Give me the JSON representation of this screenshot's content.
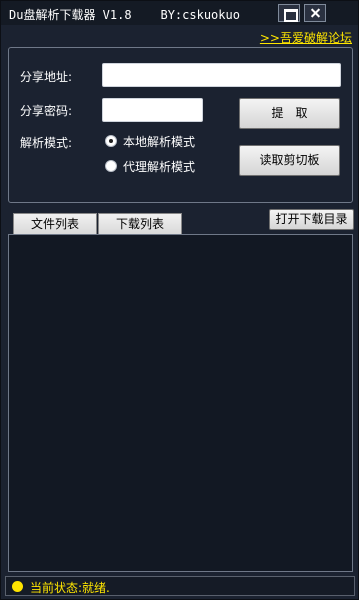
{
  "window": {
    "title": "Du盘解析下载器 V1.8    BY:cskuokuo",
    "forum_link": ">>吾爱破解论坛"
  },
  "form": {
    "share_url_label": "分享地址:",
    "share_url_value": "",
    "share_pwd_label": "分享密码:",
    "share_pwd_value": "",
    "extract_button": "提　取",
    "clipboard_button": "读取剪切板",
    "mode_label": "解析模式:",
    "modes": [
      {
        "label": "本地解析模式",
        "selected": true
      },
      {
        "label": "代理解析模式",
        "selected": false
      }
    ]
  },
  "tabs": [
    {
      "label": "文件列表",
      "active": true
    },
    {
      "label": "下载列表",
      "active": false
    }
  ],
  "open_dir_button": "打开下载目录",
  "status": {
    "text": "当前状态:就绪.",
    "indicator_color": "#ffe400"
  }
}
